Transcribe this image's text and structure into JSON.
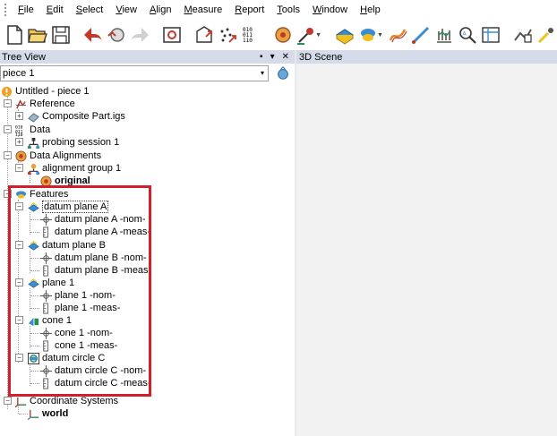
{
  "menu": {
    "items": [
      {
        "pre": "",
        "u": "F",
        "post": "ile"
      },
      {
        "pre": "",
        "u": "E",
        "post": "dit"
      },
      {
        "pre": "",
        "u": "S",
        "post": "elect"
      },
      {
        "pre": "",
        "u": "V",
        "post": "iew"
      },
      {
        "pre": "",
        "u": "A",
        "post": "lign"
      },
      {
        "pre": "",
        "u": "M",
        "post": "easure"
      },
      {
        "pre": "",
        "u": "R",
        "post": "eport"
      },
      {
        "pre": "",
        "u": "T",
        "post": "ools"
      },
      {
        "pre": "",
        "u": "W",
        "post": "indow"
      },
      {
        "pre": "",
        "u": "H",
        "post": "elp"
      }
    ]
  },
  "tree_panel": {
    "title": "Tree View",
    "pin_glyph": "▪",
    "menu_glyph": "▾",
    "close_glyph": "✕"
  },
  "scene_panel": {
    "title": "3D Scene"
  },
  "piece_combo": {
    "value": "piece 1",
    "arrow": "▾"
  },
  "tree": {
    "root": "Untitled - piece 1",
    "reference": "Reference",
    "composite": "Composite Part.igs",
    "data": "Data",
    "probing": "probing session 1",
    "data_alignments": "Data Alignments",
    "alignment_group": "alignment group 1",
    "original": "original",
    "features": "Features",
    "dpA": "datum plane A",
    "dpA_nom": "datum plane A -nom-",
    "dpA_meas": "datum plane A -meas-",
    "dpB": "datum plane B",
    "dpB_nom": "datum plane B -nom-",
    "dpB_meas": "datum plane B -meas-",
    "plane1": "plane 1",
    "plane1_nom": "plane 1 -nom-",
    "plane1_meas": "plane 1 -meas-",
    "cone1": "cone 1",
    "cone1_nom": "cone 1 -nom-",
    "cone1_meas": "cone 1 -meas-",
    "dcC": "datum circle C",
    "dcC_nom": "datum circle C -nom-",
    "dcC_meas": "datum circle C -meas-",
    "coord": "Coordinate Systems",
    "world": "world"
  },
  "colors": {
    "panel_header": "#d6dbe9",
    "highlight": "#d1202c",
    "scene_bg": "#f2f2f2"
  }
}
